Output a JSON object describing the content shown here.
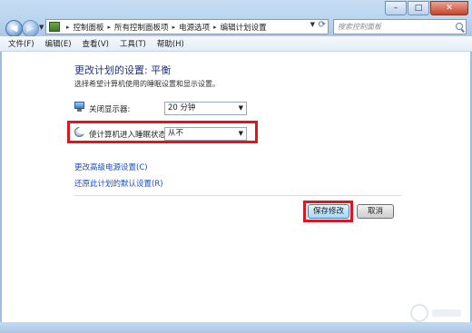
{
  "window": {
    "controls": {
      "minimize": "–",
      "maximize": "□",
      "close": "✕"
    }
  },
  "nav": {
    "back_icon": "arrow-left",
    "forward_icon": "arrow-right"
  },
  "address": {
    "breadcrumbs": [
      "控制面板",
      "所有控制面板项",
      "电源选项",
      "编辑计划设置"
    ],
    "separator": "▸"
  },
  "search": {
    "placeholder": "搜索控制面板"
  },
  "menubar": {
    "items": [
      "文件(F)",
      "编辑(E)",
      "查看(V)",
      "工具(T)",
      "帮助(H)"
    ]
  },
  "main": {
    "title": "更改计划的设置: 平衡",
    "subtitle": "选择希望计算机使用的睡眠设置和显示设置。",
    "display_off": {
      "label": "关闭显示器:",
      "value": "20 分钟"
    },
    "sleep": {
      "label": "使计算机进入睡眠状态:",
      "value": "从不"
    },
    "links": {
      "advanced": "更改高级电源设置(C)",
      "restore": "还原此计划的默认设置(R)"
    },
    "buttons": {
      "save": "保存修改",
      "cancel": "取消"
    }
  },
  "colors": {
    "highlight": "#e2141e",
    "link": "#1a4dc7",
    "heading": "#1e3287"
  }
}
